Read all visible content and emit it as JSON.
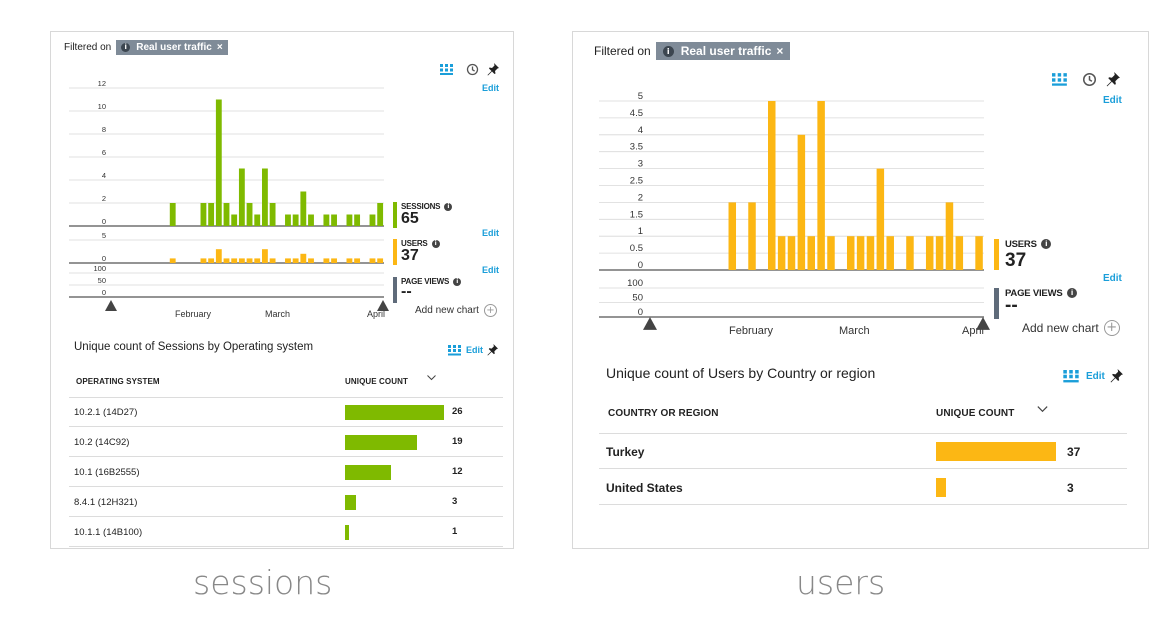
{
  "colors": {
    "sessions": "#7fba00",
    "users": "#fcb714",
    "pageviews": "#5f6b7a",
    "edit": "#1a9ed9",
    "chip": "#7f8b98",
    "grid": "#d8d8d8",
    "axis": "#444444"
  },
  "icons": {
    "grid": "grid-icon",
    "history": "history-icon",
    "pin": "pin-icon",
    "info": "info-icon",
    "plus": "plus-circle-icon",
    "close": "close-icon",
    "chevron": "chevron-down-icon",
    "slider": "range-slider-handle-icon"
  },
  "left": {
    "filter_label": "Filtered on",
    "chip_label": "Real user traffic",
    "chip_close": "×",
    "edit_labels": [
      "Edit",
      "Edit",
      "Edit",
      "Edit"
    ],
    "months": [
      "February",
      "March",
      "April"
    ],
    "add_chart": "Add new chart",
    "caption": "sessions",
    "chart_data": {
      "type": "bar",
      "title": "",
      "x_label": "",
      "y_label": "",
      "x_range_months": [
        "February",
        "March",
        "April"
      ],
      "sessions": {
        "name": "SESSIONS",
        "total": "65",
        "yticks": [
          "12",
          "10",
          "8",
          "6",
          "4",
          "2",
          "0"
        ],
        "ylim": [
          0,
          12
        ],
        "x": [
          0,
          1,
          2,
          3,
          4,
          5,
          6,
          7,
          8,
          9,
          10,
          11,
          12,
          13,
          14,
          15,
          16,
          17,
          18,
          19,
          20,
          21,
          22,
          23,
          24,
          25,
          26,
          27,
          28,
          29,
          30,
          31,
          32,
          33,
          34,
          35,
          36,
          37,
          38,
          39,
          40
        ],
        "values": [
          0,
          0,
          0,
          0,
          0,
          0,
          0,
          0,
          0,
          0,
          0,
          0,
          0,
          2,
          0,
          0,
          0,
          2,
          2,
          11,
          2,
          1,
          5,
          2,
          1,
          5,
          2,
          0,
          1,
          1,
          3,
          1,
          0,
          1,
          1,
          0,
          1,
          1,
          0,
          1,
          2
        ]
      },
      "users": {
        "name": "USERS",
        "total": "37",
        "yticks": [
          "5",
          "0"
        ],
        "ylim": [
          0,
          5
        ],
        "values": [
          0,
          0,
          0,
          0,
          0,
          0,
          0,
          0,
          0,
          0,
          0,
          0,
          0,
          1,
          0,
          0,
          0,
          1,
          1,
          3,
          1,
          1,
          1,
          1,
          1,
          3,
          1,
          0,
          1,
          1,
          2,
          1,
          0,
          1,
          1,
          0,
          1,
          1,
          0,
          1,
          1
        ]
      },
      "pageviews": {
        "name": "PAGE VIEWS",
        "total": "--",
        "yticks": [
          "100",
          "50",
          "0"
        ],
        "ylim": [
          0,
          100
        ]
      }
    },
    "table": {
      "title": "Unique count of Sessions by Operating system",
      "col1": "OPERATING SYSTEM",
      "col2": "UNIQUE COUNT",
      "toolbar_edit": "Edit",
      "rows": [
        {
          "name": "10.2.1 (14D27)",
          "value": 26
        },
        {
          "name": "10.2 (14C92)",
          "value": 19
        },
        {
          "name": "10.1 (16B2555)",
          "value": 12
        },
        {
          "name": "8.4.1 (12H321)",
          "value": 3
        },
        {
          "name": "10.1.1 (14B100)",
          "value": 1
        }
      ]
    }
  },
  "right": {
    "filter_label": "Filtered on",
    "chip_label": "Real user traffic",
    "chip_close": "×",
    "edit_labels": [
      "Edit",
      "Edit"
    ],
    "months": [
      "February",
      "March",
      "April"
    ],
    "add_chart": "Add new chart",
    "caption": "users",
    "chart_data": {
      "type": "bar",
      "title": "",
      "x_label": "",
      "y_label": "",
      "users": {
        "name": "USERS",
        "total": "37",
        "yticks": [
          "5",
          "4.5",
          "4",
          "3.5",
          "3",
          "2.5",
          "2",
          "1.5",
          "1",
          "0.5",
          "0"
        ],
        "ylim": [
          0,
          5
        ],
        "values": [
          0,
          0,
          0,
          0,
          0,
          0,
          0,
          0,
          0,
          0,
          0,
          0,
          0,
          2,
          0,
          2,
          0,
          5,
          1,
          1,
          4,
          1,
          5,
          1,
          0,
          1,
          1,
          1,
          3,
          1,
          0,
          1,
          0,
          1,
          1,
          2,
          1,
          0,
          1
        ]
      },
      "pageviews": {
        "name": "PAGE VIEWS",
        "total": "--",
        "yticks": [
          "100",
          "50",
          "0"
        ],
        "ylim": [
          0,
          100
        ]
      }
    },
    "table": {
      "title": "Unique count of Users by Country or region",
      "col1": "COUNTRY OR REGION",
      "col2": "UNIQUE COUNT",
      "toolbar_edit": "Edit",
      "rows": [
        {
          "name": "Turkey",
          "value": 37
        },
        {
          "name": "United States",
          "value": 3
        }
      ]
    }
  }
}
